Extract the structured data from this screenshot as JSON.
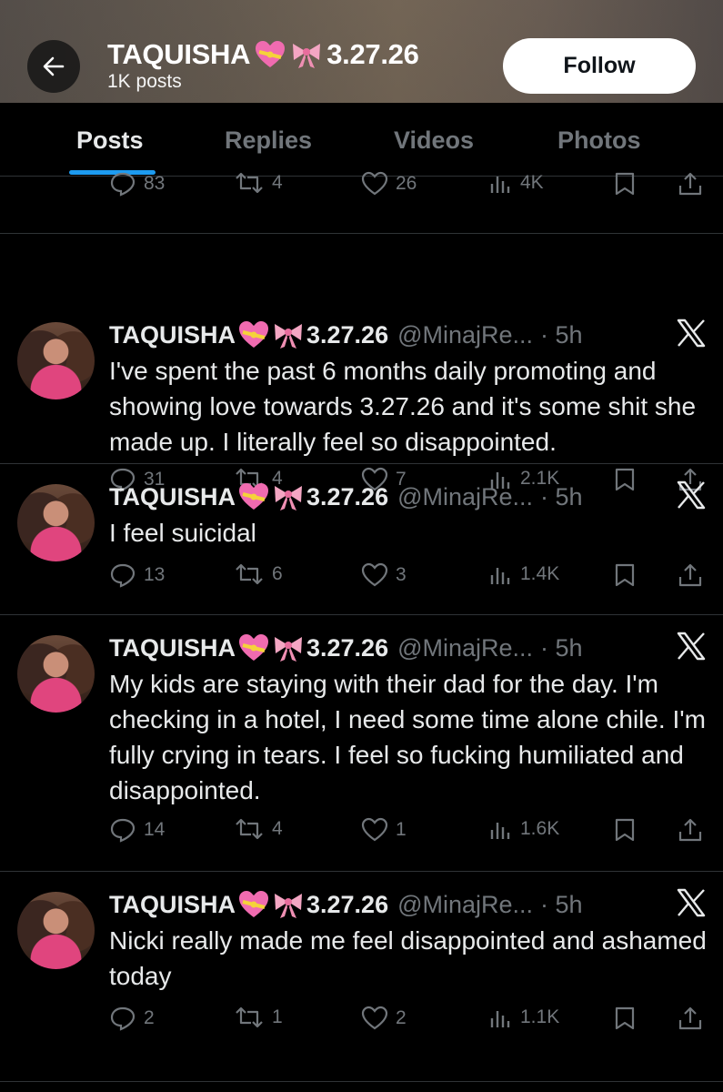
{
  "header": {
    "name": "TAQUISHA",
    "name_suffix": "3.27.26",
    "posts_count": "1K posts",
    "follow_label": "Follow"
  },
  "tabs": [
    {
      "label": "Posts",
      "active": true
    },
    {
      "label": "Replies",
      "active": false
    },
    {
      "label": "Videos",
      "active": false
    },
    {
      "label": "Photos",
      "active": false
    }
  ],
  "partial_tweet": {
    "replies": "83",
    "reposts": "4",
    "likes": "26",
    "views": "4K"
  },
  "tweets": [
    {
      "name": "TAQUISHA",
      "name_suffix": "3.27.26",
      "handle": "@MinajRe...",
      "time": "· 5h",
      "text": "I've spent the past 6 months daily promoting and showing love towards 3.27.26 and it's some shit she made up. I literally feel so disappointed.",
      "replies": "31",
      "reposts": "4",
      "likes": "7",
      "views": "2.1K"
    },
    {
      "name": "TAQUISHA",
      "name_suffix": "3.27.26",
      "handle": "@MinajRe...",
      "time": "· 5h",
      "text": "I feel suicidal",
      "replies": "13",
      "reposts": "6",
      "likes": "3",
      "views": "1.4K"
    },
    {
      "name": "TAQUISHA",
      "name_suffix": "3.27.26",
      "handle": "@MinajRe...",
      "time": "· 5h",
      "text": "My kids are staying with their dad for the day. I'm checking in a hotel, I need some time alone chile. I'm fully crying in tears. I feel so fucking humiliated and disappointed.",
      "replies": "14",
      "reposts": "4",
      "likes": "1",
      "views": "1.6K"
    },
    {
      "name": "TAQUISHA",
      "name_suffix": "3.27.26",
      "handle": "@MinajRe...",
      "time": "· 5h",
      "text": "Nicki really made me feel disappointed and ashamed today",
      "replies": "2",
      "reposts": "1",
      "likes": "2",
      "views": "1.1K"
    }
  ],
  "icons": {
    "back": "arrow-left-icon",
    "emoji_1": "heart-with-ribbon-icon",
    "emoji_2": "ribbon-bow-icon",
    "platform": "x-logo-icon",
    "reply": "reply-icon",
    "repost": "repost-icon",
    "like": "heart-icon",
    "views": "views-icon",
    "bookmark": "bookmark-icon",
    "share": "share-icon"
  },
  "colors": {
    "background": "#000000",
    "text": "#e7e9ea",
    "muted": "#71767b",
    "accent": "#1d9bf0",
    "divider": "#2f3336"
  }
}
